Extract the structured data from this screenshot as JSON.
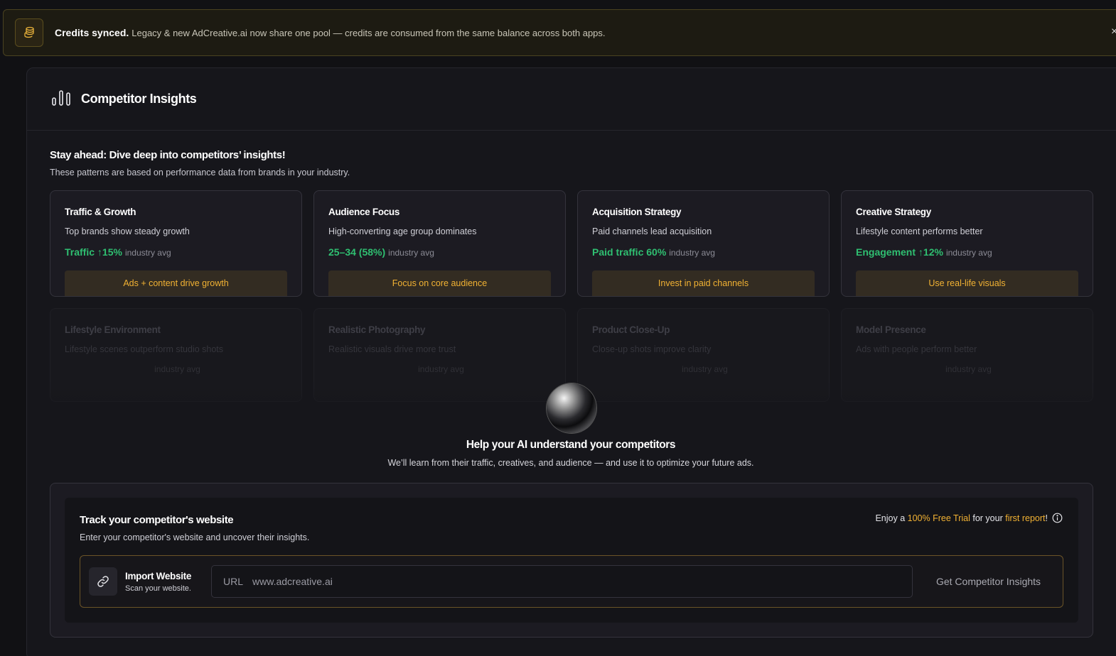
{
  "banner": {
    "title": "Credits synced.",
    "message": "Legacy & new AdCreative.ai now share one pool — credits are consumed from the same balance across both apps.",
    "icon": "coins-icon",
    "close_icon": "close-icon",
    "close_glyph": "×"
  },
  "header": {
    "title": "Competitor Insights",
    "icon": "bar-chart-icon"
  },
  "insights": {
    "title": "Stay ahead: Dive deep into competitors’ insights!",
    "subtitle": "These patterns are based on performance data from brands in your industry.",
    "cards": [
      {
        "title": "Traffic & Growth",
        "desc": "Top brands show steady growth",
        "metric": "Traffic ↑15%",
        "avg": "industry avg",
        "action": "Ads + content drive growth"
      },
      {
        "title": "Audience Focus",
        "desc": "High-converting age group dominates",
        "metric": "25–34 (58%)",
        "avg": "industry avg",
        "action": "Focus on core audience"
      },
      {
        "title": "Acquisition Strategy",
        "desc": "Paid channels lead acquisition",
        "metric": "Paid traffic 60%",
        "avg": "industry avg",
        "action": "Invest in paid channels"
      },
      {
        "title": "Creative Strategy",
        "desc": "Lifestyle content performs better",
        "metric": "Engagement ↑12%",
        "avg": "industry avg",
        "action": "Use real-life visuals"
      }
    ],
    "faded_cards": [
      {
        "title": "Lifestyle Environment",
        "desc": "Lifestyle scenes outperform studio shots",
        "avg": "industry avg"
      },
      {
        "title": "Realistic Photography",
        "desc": "Realistic visuals drive more trust",
        "avg": "industry avg"
      },
      {
        "title": "Product Close-Up",
        "desc": "Close-up shots improve clarity",
        "avg": "industry avg"
      },
      {
        "title": "Model Presence",
        "desc": "Ads with people perform better",
        "avg": "industry avg"
      }
    ]
  },
  "help": {
    "title": "Help your AI understand your competitors",
    "subtitle": "We’ll learn from their traffic, creatives, and audience — and use it to optimize your future ads."
  },
  "track": {
    "title": "Track your competitor's website",
    "subtitle": "Enter your competitor's website and uncover their insights.",
    "trial_prefix": "Enjoy a",
    "trial_highlight": "100% Free Trial",
    "trial_middle": "for your",
    "trial_highlight2": "first report",
    "trial_suffix": "!",
    "import_title": "Import Website",
    "import_sub": "Scan your website.",
    "url_label": "URL",
    "url_placeholder": "www.adcreative.ai",
    "button": "Get Competitor Insights"
  },
  "colors": {
    "accent": "#f2b233",
    "positive": "#2fbf71",
    "background": "#111114"
  }
}
